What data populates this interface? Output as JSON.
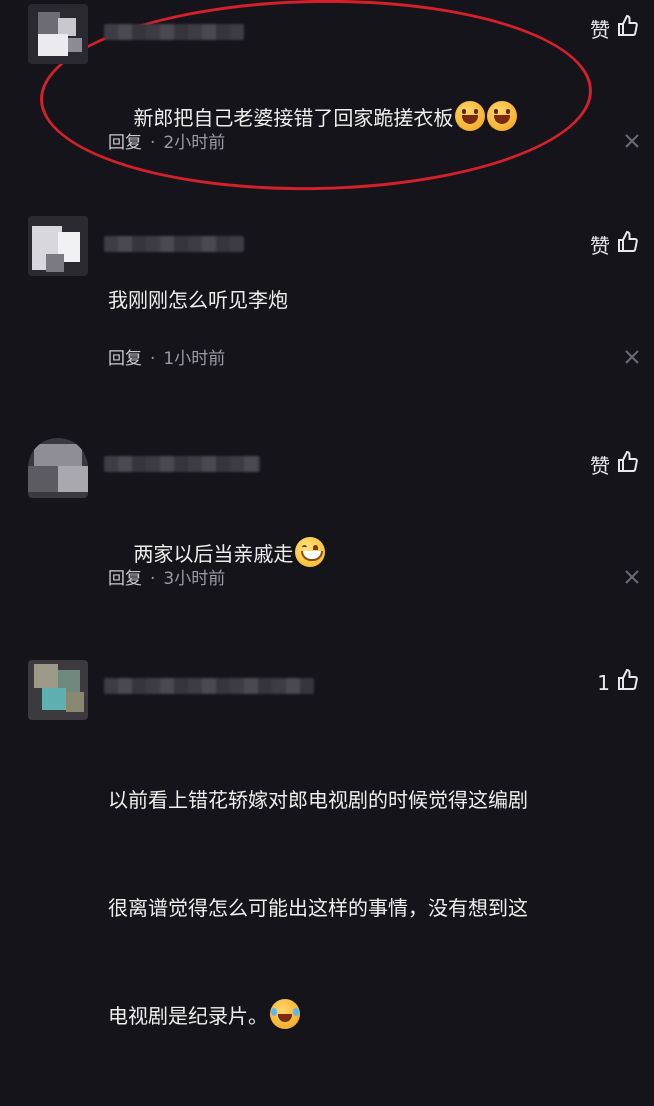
{
  "like_label": "赞",
  "comments": [
    {
      "text": "新郎把自己老婆接错了回家跪搓衣板",
      "emojis": [
        "grin",
        "grin"
      ],
      "reply": "回复",
      "time": "2小时前",
      "like": "赞"
    },
    {
      "text": "我刚刚怎么听见李炮",
      "emojis": [],
      "reply": "回复",
      "time": "1小时前",
      "like": "赞"
    },
    {
      "text": "两家以后当亲戚走",
      "emojis": [
        "smile"
      ],
      "reply": "回复",
      "time": "3小时前",
      "like": "赞"
    },
    {
      "text_lines": [
        "以前看上错花轿嫁对郎电视剧的时候觉得这编剧",
        "很离谱觉得怎么可能出这样的事情，没有想到这",
        "电视剧是纪录片。"
      ],
      "emojis": [
        "laugh"
      ],
      "like": "1"
    }
  ],
  "colors": {
    "background": "#15141b",
    "highlight": "#d4202a",
    "meta": "#9a9aa2"
  },
  "icons": [
    "thumbs-up-icon",
    "close-icon"
  ]
}
